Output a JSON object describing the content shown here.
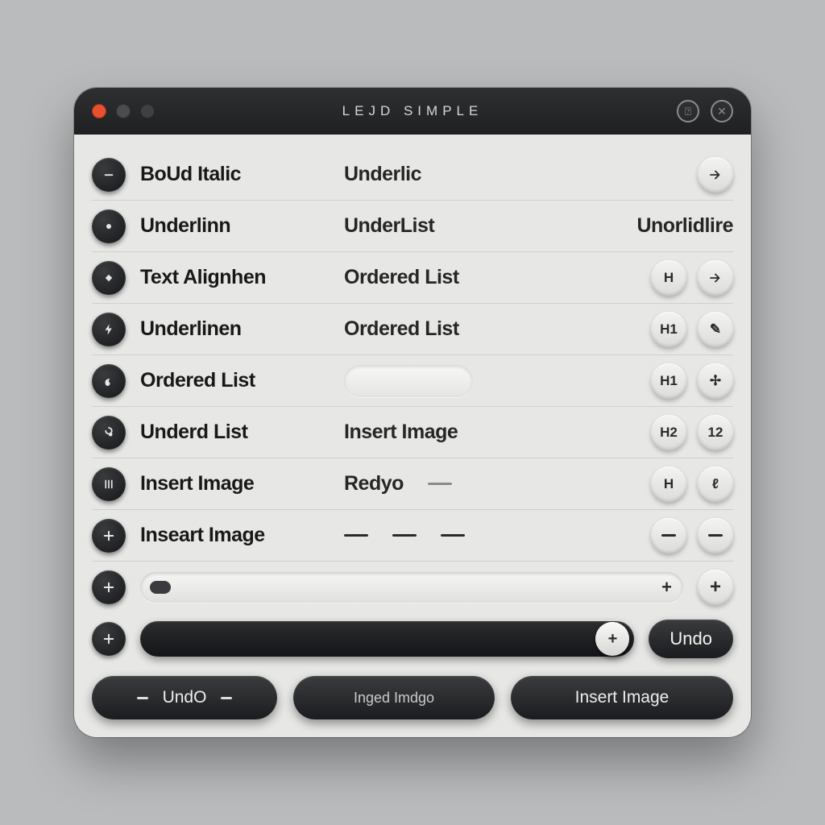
{
  "window": {
    "title": "LEJD SIMPLE"
  },
  "titlebar_icons": {
    "a": "⍰",
    "b": "✕"
  },
  "rows": [
    {
      "icon": "minus",
      "c1": "BoUd Italic",
      "c2": "Underlic",
      "end": [
        {
          "t": "glyph",
          "v": "↦"
        }
      ]
    },
    {
      "icon": "dot",
      "c1": "Underlinn",
      "c2": "UnderList",
      "extra": "Unorlidlire",
      "end": []
    },
    {
      "icon": "diamond",
      "c1": "Text Alignhen",
      "c2": "Ordered List",
      "end": [
        {
          "t": "txt",
          "v": "H"
        },
        {
          "t": "glyph",
          "v": "↦"
        }
      ]
    },
    {
      "icon": "bolt",
      "c1": "Underlinen",
      "c2": "Ordered List",
      "end": [
        {
          "t": "txt",
          "v": "H1"
        },
        {
          "t": "glyph",
          "v": "✎"
        }
      ]
    },
    {
      "icon": "curl",
      "c1": "Ordered List",
      "c2_field": true,
      "end": [
        {
          "t": "txt",
          "v": "H1"
        },
        {
          "t": "glyph",
          "v": "✢"
        }
      ]
    },
    {
      "icon": "loop",
      "c1": "Underd List",
      "c2": "Insert Image",
      "end": [
        {
          "t": "txt",
          "v": "H2"
        },
        {
          "t": "txt",
          "v": "12"
        }
      ]
    },
    {
      "icon": "marks",
      "c1": "Insert Image",
      "c2": "Redyo",
      "c2_dash": true,
      "end": [
        {
          "t": "txt",
          "v": "H"
        },
        {
          "t": "glyph",
          "v": "ℓ"
        }
      ]
    },
    {
      "icon": "plus",
      "c1": "Inseart Image",
      "c2_dashes": true,
      "end": [
        {
          "t": "dash"
        },
        {
          "t": "dash"
        }
      ]
    }
  ],
  "slider_light": {
    "plus": "+"
  },
  "slider_dark": {
    "thumb": "+"
  },
  "undo_side": "Undo",
  "footer": {
    "undo": "UndO",
    "mid": "Inged Imdgo",
    "right": "Insert Image"
  }
}
